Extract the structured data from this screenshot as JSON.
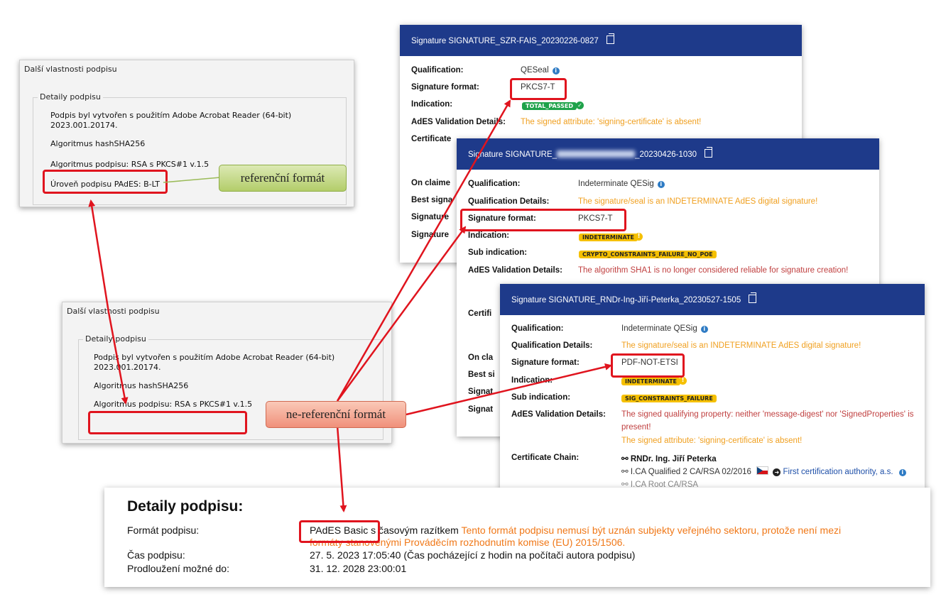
{
  "win1": {
    "title": "Další vlastnosti podpisu",
    "group_label": "Detaily podpisu",
    "line1": "Podpis byl vytvořen s použitím Adobe Acrobat Reader (64-bit)",
    "line2": "2023.001.20174.",
    "hash": "Algoritmus hashSHA256",
    "alg": "Algoritmus podpisu: RSA s PKCS#1 v.1.5",
    "level": "Úroveň podpisu PAdES: B-LT"
  },
  "win2": {
    "title": "Další vlastnosti podpisu",
    "group_label": "Detaily podpisu",
    "line1": "Podpis byl vytvořen s použitím Adobe Acrobat Reader (64-bit)",
    "line2": "2023.001.20174.",
    "hash": "Algoritmus hashSHA256",
    "alg": "Algoritmus podpisu: RSA s PKCS#1 v.1.5"
  },
  "callouts": {
    "ref": "referenční formát",
    "nonref": "ne-referenční formát"
  },
  "dss1": {
    "title": "Signature SIGNATURE_SZR-FAIS_20230226-0827",
    "qualification_label": "Qualification:",
    "qualification_value": "QESeal",
    "format_label": "Signature format:",
    "format_value": "PKCS7-T",
    "indication_label": "Indication:",
    "indication_badge": "TOTAL_PASSED",
    "ades_label": "AdES Validation Details:",
    "ades_value": "The signed attribute: 'signing-certificate' is absent!",
    "cert_label": "Certificate",
    "claimed_label": "On claime",
    "best_label": "Best signa",
    "sig1_label": "Signature",
    "sig2_label": "Signature"
  },
  "dss2": {
    "title_prefix": "Signature SIGNATURE_",
    "title_suffix": "_20230426-1030",
    "qualification_label": "Qualification:",
    "qualification_value": "Indeterminate QESig",
    "qual_details_label": "Qualification Details:",
    "qual_details_value": "The signature/seal is an INDETERMINATE AdES digital signature!",
    "format_label": "Signature format:",
    "format_value": "PKCS7-T",
    "indication_label": "Indication:",
    "indication_badge": "INDETERMINATE",
    "sub_label": "Sub indication:",
    "sub_badge": "CRYPTO_CONSTRAINTS_FAILURE_NO_POE",
    "ades_label": "AdES Validation Details:",
    "ades_value": "The algorithm SHA1 is no longer considered reliable for signature creation!",
    "certifi_label": "Certifi",
    "oncla_label": "On cla",
    "bestsi_label": "Best si",
    "signat1_label": "Signat",
    "signat2_label": "Signat"
  },
  "dss3": {
    "title": "Signature SIGNATURE_RNDr-Ing-Jiří-Peterka_20230527-1505",
    "qualification_label": "Qualification:",
    "qualification_value": "Indeterminate QESig",
    "qual_details_label": "Qualification Details:",
    "qual_details_value": "The signature/seal is an INDETERMINATE AdES digital signature!",
    "format_label": "Signature format:",
    "format_value": "PDF-NOT-ETSI",
    "indication_label": "Indication:",
    "indication_badge": "INDETERMINATE",
    "sub_label": "Sub indication:",
    "sub_badge": "SIG_CONSTRAINTS_FAILURE",
    "ades_label": "AdES Validation Details:",
    "ades_line1": "The signed qualifying property: neither 'message-digest' nor 'SignedProperties' is",
    "ades_line2": "present!",
    "ades_line3": "The signed attribute: 'signing-certificate' is absent!",
    "chain_label": "Certificate Chain:",
    "chain1": "RNDr. Ing. Jiří Peterka",
    "chain2": "I.CA Qualified 2 CA/RSA 02/2016",
    "chain2_link": "First certification authority, a.s.",
    "chain3": "I.CA Root CA/RSA"
  },
  "report": {
    "heading": "Detaily podpisu:",
    "format_label": "Formát podpisu:",
    "format_value": "PAdES Basic",
    "format_rest": " s časovým razítkem ",
    "warning1": "Tento formát podpisu nemusí být uznán subjekty veřejného sektoru, protože není mezi",
    "warning2": "formáty stanovenými Prováděcím rozhodnutím komise (EU) 2015/1506.",
    "time_label": "Čas podpisu:",
    "time_value": "27. 5. 2023 17:05:40 (Čas pocházející z hodin na počítači autora podpisu)",
    "ext_label": "Prodloužení možné do:",
    "ext_value": "31. 12. 2028 23:00:01"
  },
  "colors": {
    "dss_header": "#1e3a8a",
    "annotation_red": "#e0141e",
    "callout_green": "#c3d88a",
    "callout_red": "#f4a48e",
    "warning_orange": "#f0a020"
  }
}
